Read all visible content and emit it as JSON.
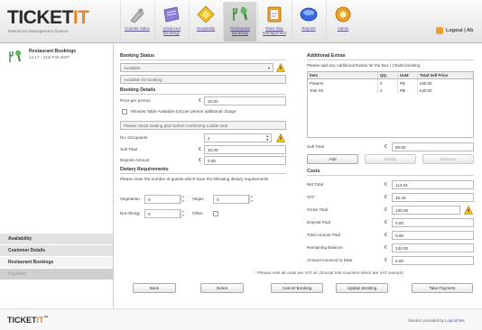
{
  "app": {
    "logo_main": "TICKET",
    "logo_accent": "IT",
    "logo_subtitle": "Resources Management System"
  },
  "nav": [
    {
      "label": "Counter Sales",
      "icon": "counter-sales-icon"
    },
    {
      "label": "Advanced Bookings",
      "icon": "advanced-bookings-icon"
    },
    {
      "label": "Hospitality",
      "icon": "hospitality-icon"
    },
    {
      "label": "Restaurant Bookings",
      "icon": "restaurant-bookings-icon"
    },
    {
      "label": "Race Day Management",
      "icon": "race-day-icon"
    },
    {
      "label": "Reports",
      "icon": "reports-icon"
    },
    {
      "label": "Admin",
      "icon": "admin-icon"
    }
  ],
  "logout_label": "Logout | Ab",
  "sidebar": {
    "title": "Restaurant Bookings",
    "subtitle": "14:17 - 21st Feb 2007",
    "items": [
      {
        "label": "Availability"
      },
      {
        "label": "Customer Details"
      },
      {
        "label": "Restaurant Bookings"
      },
      {
        "label": "Payment"
      }
    ]
  },
  "booking_status": {
    "heading": "Booking Status",
    "select_value": "Available",
    "status_text": "Available for booking"
  },
  "booking_details": {
    "heading": "Booking Details",
    "price_label": "Price per person",
    "price_value": "20.00",
    "window_label": "Window Table Available £10 per person additional charge",
    "seating_note": "Please check seating plan before confirming a table seat",
    "occupants_label": "No. Occupants",
    "occupants_value": "2",
    "subtotal_label": "Sub Total",
    "subtotal_value": "40.00",
    "deposit_label": "Deposit Amount",
    "deposit_value": "0.00"
  },
  "currency_symbol": "€",
  "dietary": {
    "heading": "Dietary Requirements",
    "description": "Please enter the number of guests which have the following dietary requirements",
    "vegetarian_label": "Vegetarian",
    "vegetarian_value": "0",
    "vegan_label": "Vegan",
    "vegan_value": "0",
    "nut_label": "Nut Allergy",
    "nut_value": "0",
    "other_label": "Other"
  },
  "extras": {
    "heading": "Additional Extras",
    "description": "Please add any Additional Extras for the Box / Chalet booking",
    "columns": [
      "Item",
      "Qty",
      "UoM",
      "Total Sell Price"
    ],
    "rows": [
      [
        "Flowers",
        "2",
        "PB",
        "£60.00"
      ],
      [
        "Tote X5",
        "4",
        "PB",
        "£20.00"
      ]
    ],
    "subtotal_label": "Sub Total",
    "subtotal_value": "80.00",
    "add_label": "Add",
    "modify_label": "Modify",
    "remove_label": "Remove"
  },
  "costs": {
    "heading": "Costs",
    "rows": [
      {
        "label": "Net Total",
        "value": "114.04"
      },
      {
        "label": "VAT",
        "value": "15.46"
      },
      {
        "label": "Gross Total",
        "value": "130.00"
      },
      {
        "label": "Deposit Paid",
        "value": "0.00"
      },
      {
        "label": "Total Amount Paid",
        "value": "0.00"
      },
      {
        "label": "Remaining Balance",
        "value": "130.00"
      },
      {
        "label": "Amount Invoiced to Date",
        "value": "0.00"
      }
    ]
  },
  "vat_note": "* Please note all costs are VAT inc (Except tote vouchers which are VAT exempt)",
  "buttons": {
    "back": "Back",
    "notes": "Notes",
    "cancel_booking": "Cancel Booking",
    "update_booking": "Update Booking",
    "take_payment": "Take Payment"
  },
  "footer": {
    "logo_main": "TICKET",
    "logo_accent": "IT",
    "logo_tm": "™",
    "credit": "Solution provided by ",
    "credit_link": "Logical We"
  }
}
